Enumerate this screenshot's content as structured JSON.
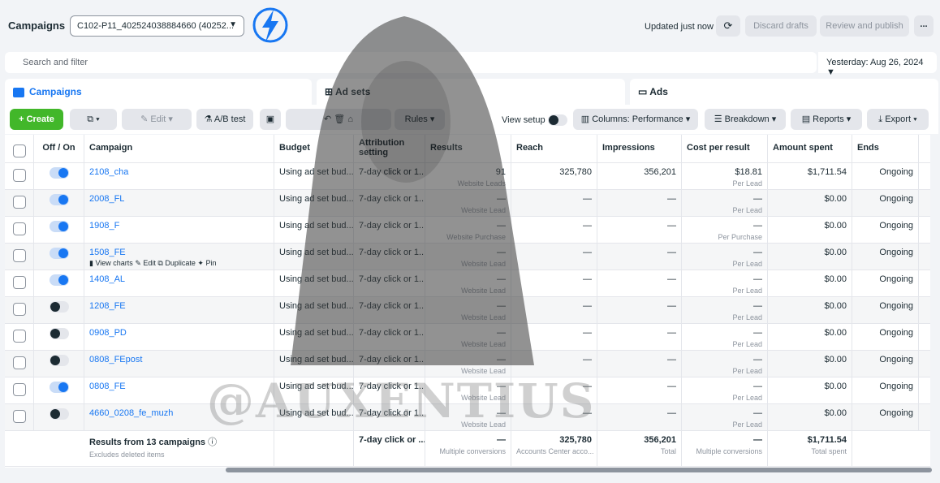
{
  "header": {
    "title": "Campaigns",
    "account": "C102-P11_402524038884660 (40252...",
    "updated": "Updated just now",
    "discard": "Discard drafts",
    "review": "Review and publish",
    "more": "..."
  },
  "search": {
    "placeholder": "Search and filter",
    "date": "Yesterday: Aug 26, 2024"
  },
  "tabs": [
    {
      "label": "Campaigns"
    },
    {
      "label": "Ad sets"
    },
    {
      "label": "Ads"
    }
  ],
  "toolbar": {
    "create": "Create",
    "edit": "Edit",
    "ab": "A/B test",
    "rules": "Rules",
    "view_setup": "View setup",
    "columns": "Columns: Performance",
    "breakdown": "Breakdown",
    "reports": "Reports",
    "export": "Export"
  },
  "columns": [
    "Off / On",
    "Campaign",
    "Budget",
    "Attribution setting",
    "Results",
    "Reach",
    "Impressions",
    "Cost per result",
    "Amount spent",
    "Ends"
  ],
  "hover_actions": [
    "View charts",
    "Edit",
    "Duplicate",
    "Pin"
  ],
  "rows": [
    {
      "name": "2108_cha",
      "on": true,
      "budget": "Using ad set bud...",
      "attr": "7-day click or 1...",
      "results": "91",
      "results_sub": "Website Leads",
      "reach": "325,780",
      "impr": "356,201",
      "cpr": "$18.81",
      "cpr_sub": "Per Lead",
      "spent": "$1,711.54",
      "ends": "Ongoing"
    },
    {
      "name": "2008_FL",
      "on": true,
      "budget": "Using ad set bud...",
      "attr": "7-day click or 1...",
      "results": "—",
      "results_sub": "Website Lead",
      "reach": "—",
      "impr": "—",
      "cpr": "—",
      "cpr_sub": "Per Lead",
      "spent": "$0.00",
      "ends": "Ongoing"
    },
    {
      "name": "1908_F",
      "on": true,
      "budget": "Using ad set bud...",
      "attr": "7-day click or 1...",
      "results": "—",
      "results_sub": "Website Purchase",
      "reach": "—",
      "impr": "—",
      "cpr": "—",
      "cpr_sub": "Per Purchase",
      "spent": "$0.00",
      "ends": "Ongoing"
    },
    {
      "name": "1508_FE",
      "on": true,
      "budget": "Using ad set bud...",
      "attr": "7-day click or 1...",
      "results": "—",
      "results_sub": "Website Lead",
      "reach": "—",
      "impr": "—",
      "cpr": "—",
      "cpr_sub": "Per Lead",
      "spent": "$0.00",
      "ends": "Ongoing"
    },
    {
      "name": "1408_AL",
      "on": true,
      "budget": "Using ad set bud...",
      "attr": "7-day click or 1...",
      "results": "—",
      "results_sub": "Website Lead",
      "reach": "—",
      "impr": "—",
      "cpr": "—",
      "cpr_sub": "Per Lead",
      "spent": "$0.00",
      "ends": "Ongoing"
    },
    {
      "name": "1208_FE",
      "on": false,
      "budget": "Using ad set bud...",
      "attr": "7-day click or 1...",
      "results": "—",
      "results_sub": "Website Lead",
      "reach": "—",
      "impr": "—",
      "cpr": "—",
      "cpr_sub": "Per Lead",
      "spent": "$0.00",
      "ends": "Ongoing"
    },
    {
      "name": "0908_PD",
      "on": false,
      "budget": "Using ad set bud...",
      "attr": "7-day click or 1...",
      "results": "—",
      "results_sub": "Website Lead",
      "reach": "—",
      "impr": "—",
      "cpr": "—",
      "cpr_sub": "Per Lead",
      "spent": "$0.00",
      "ends": "Ongoing"
    },
    {
      "name": "0808_FEpost",
      "on": false,
      "budget": "Using ad set bud...",
      "attr": "7-day click or 1...",
      "results": "—",
      "results_sub": "Website Lead",
      "reach": "—",
      "impr": "—",
      "cpr": "—",
      "cpr_sub": "Per Lead",
      "spent": "$0.00",
      "ends": "Ongoing"
    },
    {
      "name": "0808_FE",
      "on": true,
      "budget": "Using ad set bud...",
      "attr": "7-day click or 1...",
      "results": "—",
      "results_sub": "Website Lead",
      "reach": "—",
      "impr": "—",
      "cpr": "—",
      "cpr_sub": "Per Lead",
      "spent": "$0.00",
      "ends": "Ongoing"
    },
    {
      "name": "4660_0208_fe_muzh",
      "on": false,
      "budget": "Using ad set bud...",
      "attr": "7-day click or 1...",
      "results": "—",
      "results_sub": "Website Lead",
      "reach": "—",
      "impr": "—",
      "cpr": "—",
      "cpr_sub": "Per Lead",
      "spent": "$0.00",
      "ends": "Ongoing"
    }
  ],
  "summary": {
    "label": "Results from 13 campaigns",
    "sub": "Excludes deleted items",
    "attr": "7-day click or ...",
    "results": "—",
    "results_sub": "Multiple conversions",
    "reach": "325,780",
    "reach_sub": "Accounts Center acco...",
    "impr": "356,201",
    "impr_sub": "Total",
    "cpr": "—",
    "cpr_sub": "Multiple conversions",
    "spent": "$1,711.54",
    "spent_sub": "Total spent"
  },
  "watermark": "@AUXENTIUS",
  "colors": {
    "accent": "#1877f2",
    "create": "#42b72a"
  }
}
